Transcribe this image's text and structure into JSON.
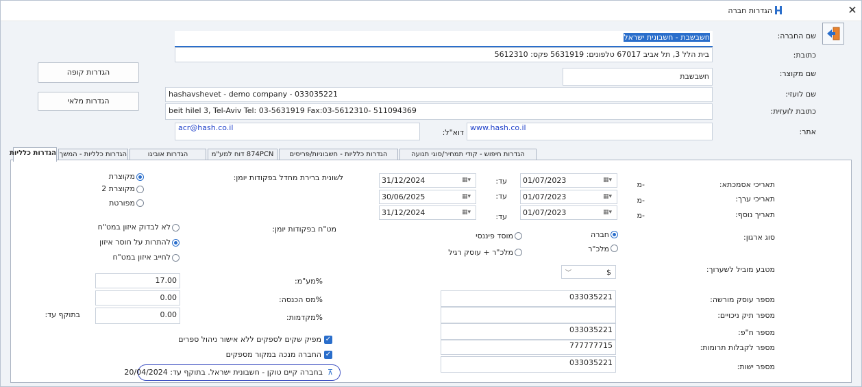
{
  "window": {
    "title": "הגדרות חברה",
    "close_symbol": "✕"
  },
  "buttons": {
    "cash_settings": "הגדרות קופה",
    "inventory_settings": "הגדרות מלאי"
  },
  "company": {
    "name_label": "שם החברה:",
    "name_value": "חשבשבת - חשבונית ישראל",
    "address_label": "כתובת:",
    "address_value": "בית הלל 3, תל אביב  67017   טלפונים: 5631919  פקס: 5612310",
    "short_name_label": "שם מקוצר:",
    "short_name_value": "חשבשבת",
    "foreign_name_label": "שם לועזי:",
    "foreign_name_value": "hashavshevet - demo company - 033035221",
    "foreign_address_label": "כתובת לועזית:",
    "foreign_address_value": "beit hilel 3,  Tel-Aviv   Tel: 03-5631919   Fax:03-5612310-   511094369",
    "site_label": "אתר:",
    "site_value": "www.hash.co.il",
    "email_label": "דוא\"ל:",
    "email_value": "acr@hash.co.il"
  },
  "tabs": [
    {
      "label": "הגדרות כלליות",
      "active": true
    },
    {
      "label": "הגדרות כלליות - המשך",
      "active": false
    },
    {
      "label": "הגדרות אוביגו",
      "active": false
    },
    {
      "label": "874PCN דוח למע\"מ",
      "active": false
    },
    {
      "label": "הגדרות כלליות - חשבוניות/פריסים",
      "active": false
    },
    {
      "label": "הגדרות חיפוש - קודי תמחיר/סוגי תנועה",
      "active": false
    }
  ],
  "dates": {
    "reference_label": "תאריכי אסמכתא:",
    "value_label": "תאריכי ערך:",
    "extra_label": "תאריך נוסף:",
    "from": "-מ",
    "to": "עד:",
    "rows": [
      {
        "from": "01/07/2023",
        "to": "31/12/2024"
      },
      {
        "from": "01/07/2023",
        "to": "30/06/2025"
      },
      {
        "from": "01/07/2023",
        "to": "31/12/2024"
      }
    ]
  },
  "journal_tab": {
    "label": "לשונית ברירת מחדל בפקודות יומן:",
    "options": [
      "מקוצרת",
      "מקוצרת 2",
      "מפורטת"
    ],
    "selected": 0
  },
  "vat_journal": {
    "label": "מט\"ח בפקודות יומן:",
    "options": [
      "לא לבדוק איזון במט\"ח",
      "להתרות על חוסר איזון",
      "לחייב איזון במט\"ח"
    ],
    "selected": 1
  },
  "org_type": {
    "label": "סוג ארגון:",
    "options": [
      "חברה",
      "מוסד פיננסי",
      "מלכ\"ר",
      "מלכ\"ר + עוסק רגיל"
    ],
    "selected": 0
  },
  "currency": {
    "label": "מטבע מוביל לשערוך:",
    "value": "$"
  },
  "rates": {
    "vat_label": "%מע\"מ:",
    "vat_value": "17.00",
    "income_tax_label": "%מס הכנסה:",
    "income_tax_value": "0.00",
    "advance_label": "%מקדמות:",
    "advance_value": "0.00",
    "valid_until_label": "בתוקף עד:"
  },
  "ids": {
    "dealer_label": "מספר עוסק מורשה:",
    "dealer_value": "033035221",
    "deductions_label": "מספר תיק ניכויים:",
    "deductions_value": "",
    "company_label": "מספר ח\"פ:",
    "company_value": "033035221",
    "donations_label": "מספר לקבלות תרומות:",
    "donations_value": "777777715",
    "entity_label": "מספר ישות:",
    "entity_value": "033035221"
  },
  "checks": {
    "issue_checks": "מפיק שקים לספקים ללא אישור ניהול ספרים",
    "deduct_source": "החברה מנכה במקור מספקים"
  },
  "cert_notice": "בחברה קיים טוקן - חשבונית ישראל.  בתוקף עד: 20/04/2024",
  "colors": {
    "accent": "#2a6ecb",
    "oval": "#3f51c2"
  }
}
